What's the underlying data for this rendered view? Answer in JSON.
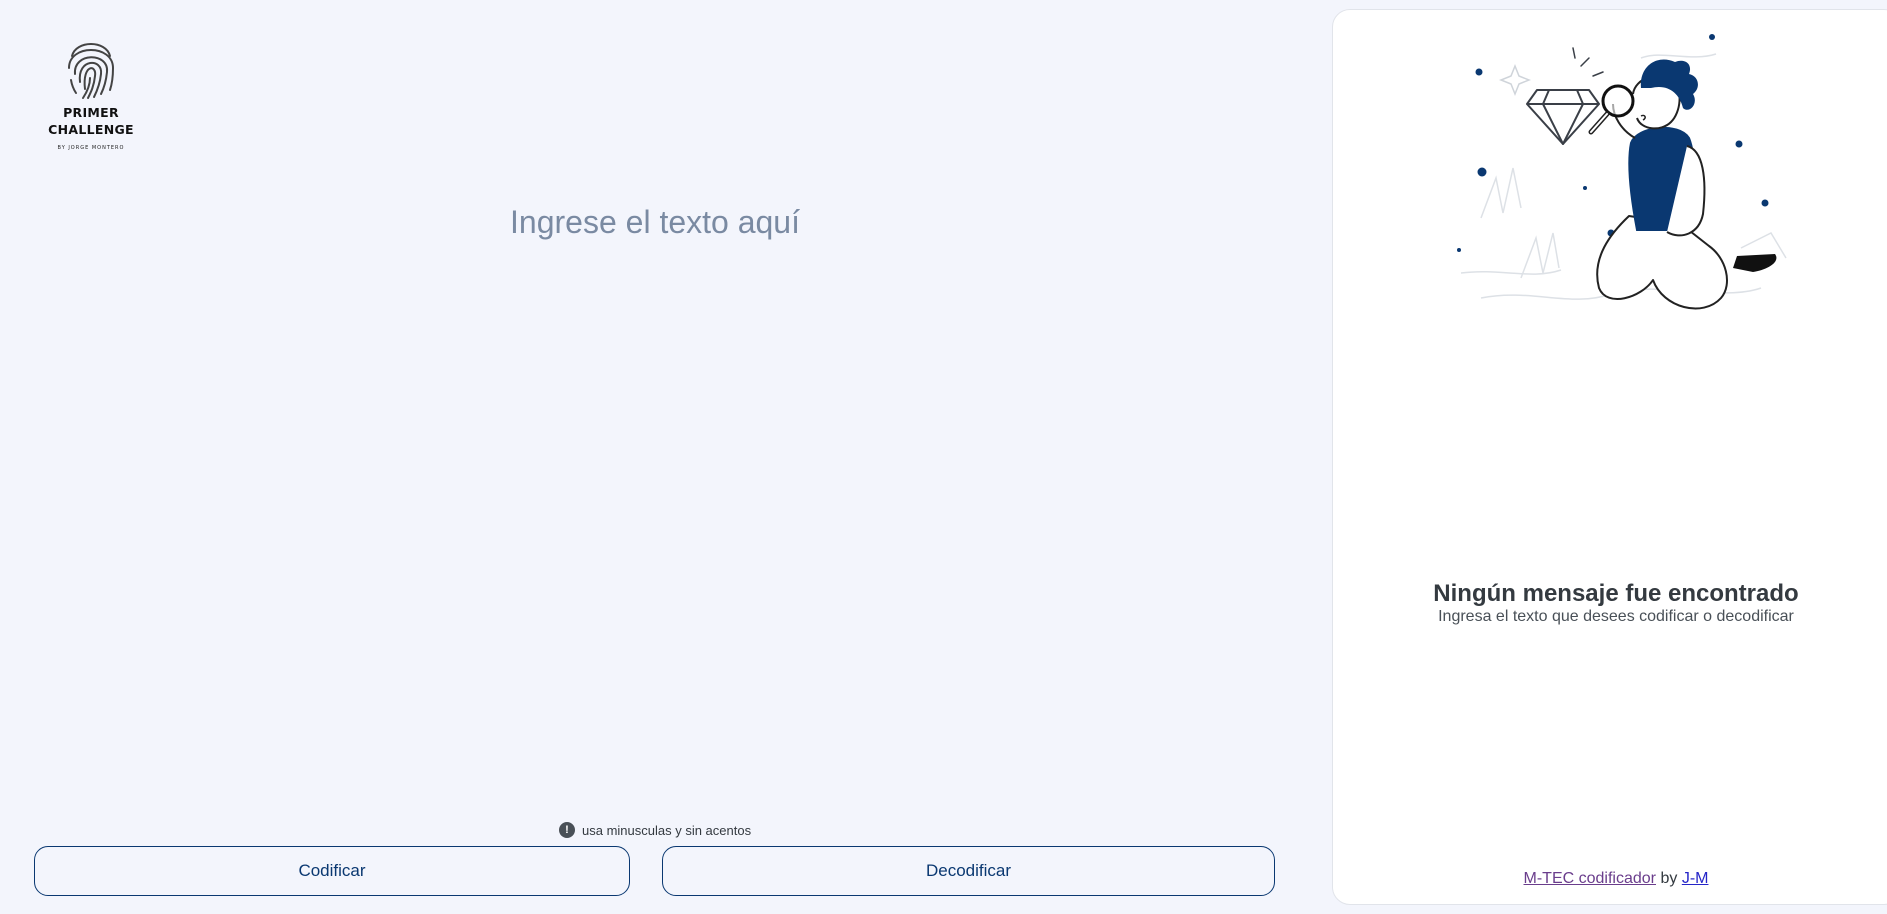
{
  "logo": {
    "icon": "fingerprint-icon",
    "title_line1": "PRIMER",
    "title_line2": "CHALLENGE",
    "byline": "BY JORGE MONTERO"
  },
  "editor": {
    "placeholder": "Ingrese el texto aquí",
    "value": ""
  },
  "hint": {
    "icon": "exclamation-circle-icon",
    "text": "usa minusculas y sin acentos"
  },
  "buttons": {
    "encode_label": "Codificar",
    "decode_label": "Decodificar"
  },
  "output_panel": {
    "illustration": "person-with-magnifying-glass-illustration",
    "title": "Ningún mensaje fue encontrado",
    "subtitle": "Ingresa el texto que desees codificar o decodificar"
  },
  "footer": {
    "project_link": "M-TEC codificador",
    "by_text": "by",
    "author_link": "J-M"
  },
  "colors": {
    "background": "#f3f5fc",
    "accent": "#0a3871",
    "placeholder": "#7a8aa2"
  }
}
